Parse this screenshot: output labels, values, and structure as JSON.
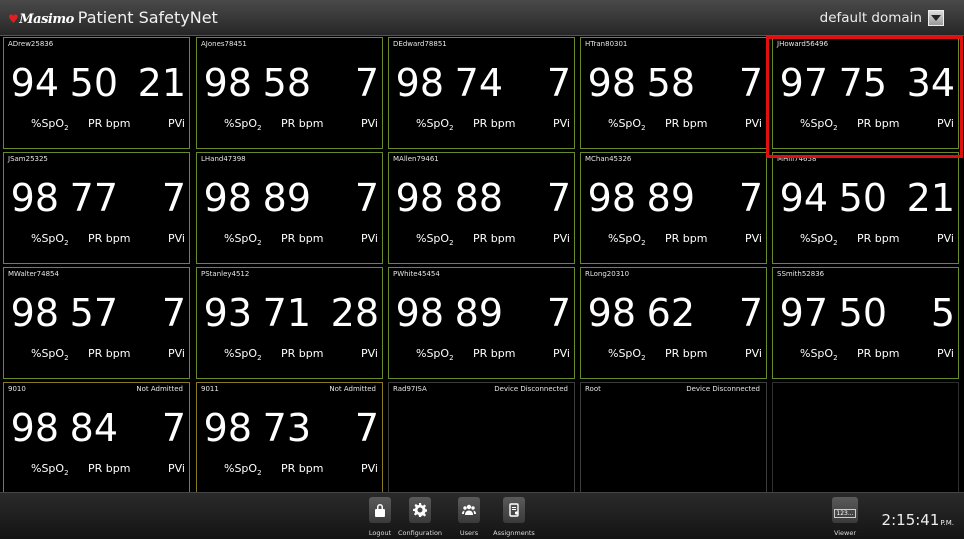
{
  "app": {
    "logo": "Masimo",
    "title": "Patient SafetyNet",
    "domain_label": "default domain"
  },
  "labels": {
    "spo2": "%SpO",
    "spo2_sub": "2",
    "pr": "PR bpm",
    "pvi": "PVi"
  },
  "tiles": [
    {
      "name": "ADrew25836",
      "status": "",
      "spo2": "94",
      "pr": "50",
      "pvi": "21",
      "state": "ok"
    },
    {
      "name": "AJones78451",
      "status": "",
      "spo2": "98",
      "pr": "58",
      "pvi": "7",
      "state": "ok"
    },
    {
      "name": "DEdward78851",
      "status": "",
      "spo2": "98",
      "pr": "74",
      "pvi": "7",
      "state": "ok"
    },
    {
      "name": "HTran80301",
      "status": "",
      "spo2": "98",
      "pr": "58",
      "pvi": "7",
      "state": "ok"
    },
    {
      "name": "JHoward56496",
      "status": "",
      "spo2": "97",
      "pr": "75",
      "pvi": "34",
      "state": "ok",
      "selected": true
    },
    {
      "name": "JSam25325",
      "status": "",
      "spo2": "98",
      "pr": "77",
      "pvi": "7",
      "state": "ok"
    },
    {
      "name": "LHand47398",
      "status": "",
      "spo2": "98",
      "pr": "89",
      "pvi": "7",
      "state": "ok"
    },
    {
      "name": "MAllen79461",
      "status": "",
      "spo2": "98",
      "pr": "88",
      "pvi": "7",
      "state": "ok"
    },
    {
      "name": "MChan45326",
      "status": "",
      "spo2": "98",
      "pr": "89",
      "pvi": "7",
      "state": "ok"
    },
    {
      "name": "MHill74658",
      "status": "",
      "spo2": "94",
      "pr": "50",
      "pvi": "21",
      "state": "ok"
    },
    {
      "name": "MWalter74854",
      "status": "",
      "spo2": "98",
      "pr": "57",
      "pvi": "7",
      "state": "ok"
    },
    {
      "name": "PStanley4512",
      "status": "",
      "spo2": "93",
      "pr": "71",
      "pvi": "28",
      "state": "ok"
    },
    {
      "name": "PWhite45454",
      "status": "",
      "spo2": "98",
      "pr": "89",
      "pvi": "7",
      "state": "ok"
    },
    {
      "name": "RLong20310",
      "status": "",
      "spo2": "98",
      "pr": "62",
      "pvi": "7",
      "state": "ok"
    },
    {
      "name": "SSmith52836",
      "status": "",
      "spo2": "97",
      "pr": "50",
      "pvi": "5",
      "state": "ok"
    },
    {
      "name": "9010",
      "status": "Not Admitted",
      "spo2": "98",
      "pr": "84",
      "pvi": "7",
      "state": "na"
    },
    {
      "name": "9011",
      "status": "Not Admitted",
      "spo2": "98",
      "pr": "73",
      "pvi": "7",
      "state": "na"
    },
    {
      "name": "Rad97ISA",
      "status": "Device Disconnected",
      "state": "disc"
    },
    {
      "name": "Root",
      "status": "Device Disconnected",
      "state": "disc"
    },
    {
      "name": "",
      "status": "",
      "state": "empty"
    }
  ],
  "toolbar": {
    "logout": "Logout",
    "configuration": "Configuration",
    "users": "Users",
    "assignments": "Assignments",
    "viewer": "Viewer",
    "viewer_badge": "123..."
  },
  "clock": {
    "time": "2:15:41",
    "ampm": "P.M."
  },
  "icons": {
    "logout": "lock-icon",
    "configuration": "gear-icon",
    "users": "users-icon",
    "assignments": "assignments-icon",
    "viewer": "viewer-icon"
  },
  "colors": {
    "tile_border_active": "#6a8a2a",
    "tile_border_not_admitted": "#8a7a20",
    "selection": "#e01010"
  }
}
